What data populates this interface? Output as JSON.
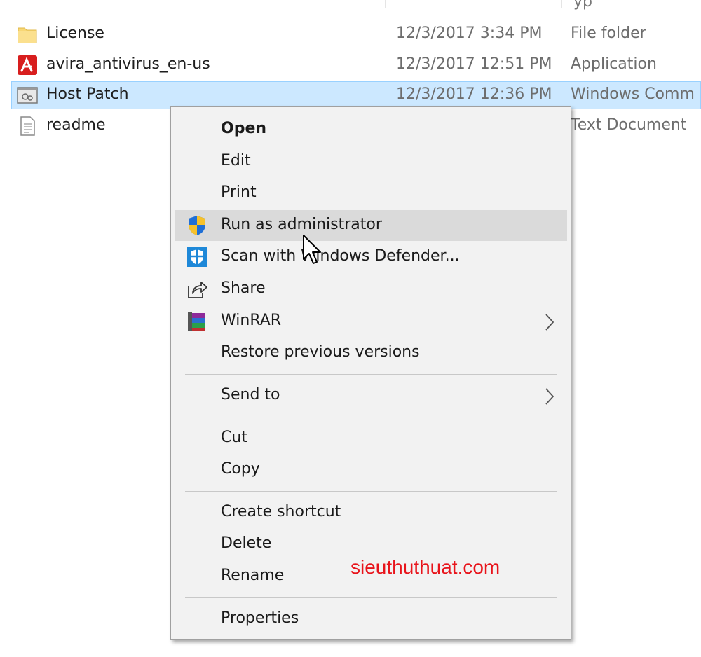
{
  "header": {
    "type_col_fragment": "ур"
  },
  "files": [
    {
      "name": "License",
      "date": "12/3/2017 3:34 PM",
      "type": "File folder",
      "icon": "folder-icon"
    },
    {
      "name": "avira_antivirus_en-us",
      "date": "12/3/2017 12:51 PM",
      "type": "Application",
      "icon": "avira-icon"
    },
    {
      "name": "Host Patch",
      "date": "12/3/2017 12:36 PM",
      "type": "Windows Comm",
      "icon": "batch-file-icon",
      "selected": true
    },
    {
      "name": "readme",
      "date": "",
      "type": "Text Document",
      "icon": "text-document-icon"
    }
  ],
  "menu": {
    "open": "Open",
    "edit": "Edit",
    "print": "Print",
    "run_as_admin": "Run as administrator",
    "scan_defender": "Scan with Windows Defender...",
    "share": "Share",
    "winrar": "WinRAR",
    "restore": "Restore previous versions",
    "send_to": "Send to",
    "cut": "Cut",
    "copy": "Copy",
    "create_shortcut": "Create shortcut",
    "delete": "Delete",
    "rename": "Rename",
    "properties": "Properties"
  },
  "watermark": "sieuthuthuat.com",
  "colors": {
    "selection": "#cce8ff",
    "hover": "#dadada",
    "watermark": "#e8141b"
  }
}
